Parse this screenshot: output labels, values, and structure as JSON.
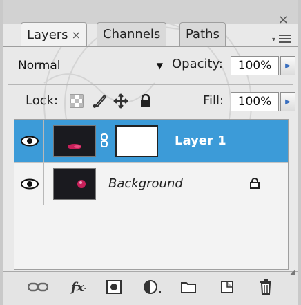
{
  "tabs": [
    {
      "label": "Layers",
      "active": true,
      "close": "×"
    },
    {
      "label": "Channels",
      "active": false
    },
    {
      "label": "Paths",
      "active": false
    }
  ],
  "window_close": "×",
  "blend_mode": "Normal",
  "opacity": {
    "label": "Opacity:",
    "value": "100%"
  },
  "lock": {
    "label": "Lock:",
    "icons": [
      "transparency-lock-icon",
      "brush-lock-icon",
      "move-lock-icon",
      "padlock-icon"
    ]
  },
  "fill": {
    "label": "Fill:",
    "value": "100%"
  },
  "layers": [
    {
      "name": "Layer 1",
      "selected": true,
      "visible": true,
      "has_mask": true
    },
    {
      "name": "Background",
      "selected": false,
      "visible": true,
      "locked": true
    }
  ],
  "toolbar": {
    "icons": [
      "link-layers-icon",
      "fx-icon",
      "add-mask-icon",
      "adjustment-layer-icon",
      "new-group-icon",
      "new-layer-icon",
      "trash-icon"
    ],
    "fx_label": "fx"
  },
  "colors": {
    "selection": "#3c9bd8",
    "panel": "#e9e9e9"
  }
}
